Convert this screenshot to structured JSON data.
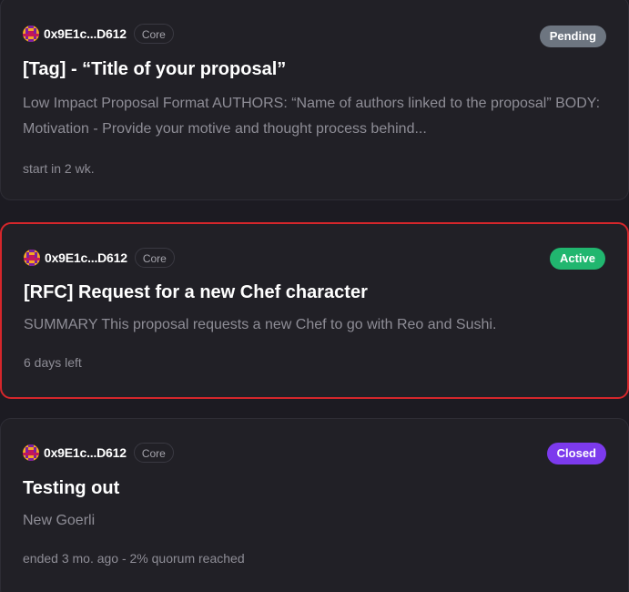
{
  "proposals": [
    {
      "author": "0x9E1c...D612",
      "space_badge": "Core",
      "state": "Pending",
      "title": "[Tag] - “Title of your proposal”",
      "body": "Low Impact Proposal Format AUTHORS: “Name of authors linked to the proposal” BODY: Motivation - Provide your motive and thought process behind...",
      "meta": "start in 2 wk.",
      "highlighted": false
    },
    {
      "author": "0x9E1c...D612",
      "space_badge": "Core",
      "state": "Active",
      "title": "[RFC] Request for a new Chef character",
      "body": "SUMMARY This proposal requests a new Chef to go with Reo and Sushi.",
      "meta": "6 days left",
      "highlighted": true
    },
    {
      "author": "0x9E1c...D612",
      "space_badge": "Core",
      "state": "Closed",
      "title": "Testing out",
      "body": "New Goerli",
      "meta": "ended 3 mo. ago - 2% quorum reached",
      "highlighted": false
    }
  ],
  "colors": {
    "background": "#1c1b22",
    "card": "#212026",
    "highlight_border": "#d5262b",
    "pending": "#6d7580",
    "active": "#21b66f",
    "closed": "#7c3aed"
  },
  "icons": {
    "avatar": "blockie-avatar-icon"
  }
}
